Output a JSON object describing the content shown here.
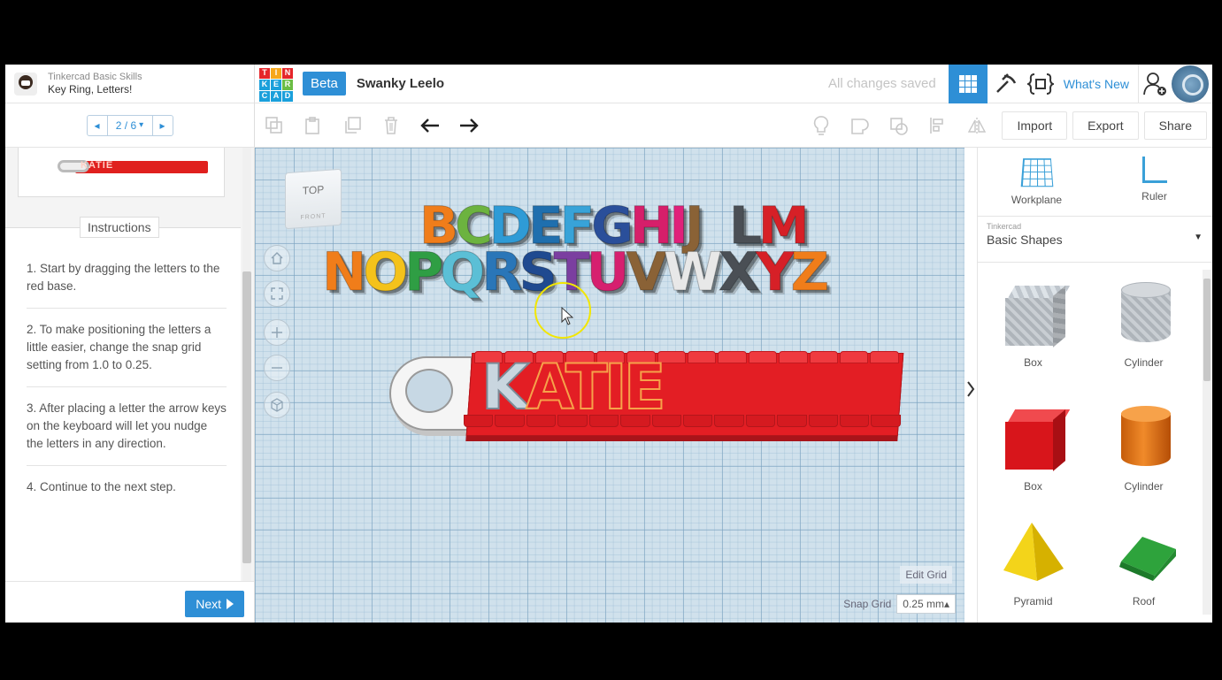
{
  "lesson": {
    "course": "Tinkercad Basic Skills",
    "name": "Key Ring, Letters!",
    "step": "2 / 6",
    "step_caret": "▾",
    "prev_glyph": "◂",
    "next_glyph": "▸",
    "instructions_tab": "Instructions",
    "instructions": [
      "1. Start by dragging the letters to the red base.",
      "2. To make positioning the letters a little easier, change the snap grid setting from 1.0 to 0.25.",
      "3. After placing a letter the arrow keys on the keyboard will let you nudge the letters in any direction.",
      "4. Continue to the next step."
    ],
    "next_label": "Next",
    "thumb_text": "KATIE"
  },
  "topbar": {
    "logo_letters": [
      "T",
      "I",
      "N",
      "K",
      "E",
      "R",
      "C",
      "A",
      "D"
    ],
    "beta_label": "Beta",
    "design_name": "Swanky Leelo",
    "save_status": "All changes saved",
    "whats_new": "What's New"
  },
  "toolbar": {
    "import_label": "Import",
    "export_label": "Export",
    "share_label": "Share"
  },
  "workplane": {
    "viewcube_top": "TOP",
    "viewcube_front": "FRONT",
    "letters_row1": [
      {
        "ch": "B",
        "color": "#f07d1a"
      },
      {
        "ch": "C",
        "color": "#6cb33f"
      },
      {
        "ch": "D",
        "color": "#2f9bd6"
      },
      {
        "ch": "E",
        "color": "#1f6fae"
      },
      {
        "ch": "F",
        "color": "#38a3d8"
      },
      {
        "ch": "G",
        "color": "#2a4f9a"
      },
      {
        "ch": "H",
        "color": "#d61f6a"
      },
      {
        "ch": "I",
        "color": "#e0207a"
      },
      {
        "ch": "J",
        "color": "#8a6236"
      },
      {
        "ch": " ",
        "color": "#000000"
      },
      {
        "ch": "L",
        "color": "#4a4f55"
      },
      {
        "ch": "M",
        "color": "#d62027"
      }
    ],
    "letters_row2": [
      {
        "ch": "N",
        "color": "#f07d1a"
      },
      {
        "ch": "O",
        "color": "#f4c21b"
      },
      {
        "ch": "P",
        "color": "#2f9e44"
      },
      {
        "ch": "Q",
        "color": "#5bbfd6"
      },
      {
        "ch": "R",
        "color": "#2a76b8"
      },
      {
        "ch": "S",
        "color": "#1f4a90"
      },
      {
        "ch": "T",
        "color": "#7b3fa0"
      },
      {
        "ch": "U",
        "color": "#d6206f"
      },
      {
        "ch": "V",
        "color": "#8a6236"
      },
      {
        "ch": "W",
        "color": "#e8e8e8"
      },
      {
        "ch": "X",
        "color": "#4a4f55"
      },
      {
        "ch": "Y",
        "color": "#d62027"
      },
      {
        "ch": "Z",
        "color": "#f07d1a"
      }
    ],
    "keyring_k": "K",
    "keyring_rest": "ATIE",
    "edit_grid": "Edit Grid",
    "snap_grid_label": "Snap Grid",
    "snap_grid_value": "0.25 mm▴"
  },
  "right_panel": {
    "workplane_label": "Workplane",
    "ruler_label": "Ruler",
    "category_small": "Tinkercad",
    "category_name": "Basic Shapes",
    "shapes": [
      "Box",
      "Cylinder",
      "Box",
      "Cylinder",
      "Pyramid",
      "Roof"
    ]
  },
  "colors": {
    "accent": "#2e8fd6",
    "base_red": "#e31e24"
  }
}
